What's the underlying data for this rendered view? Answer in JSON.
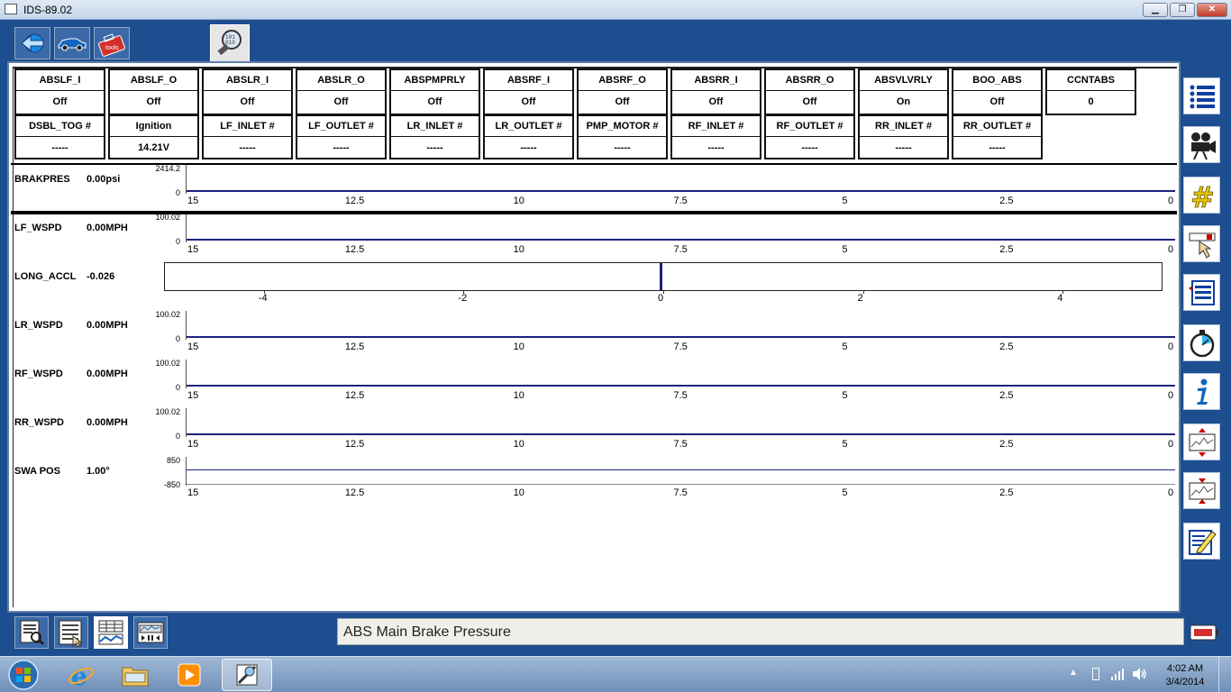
{
  "window": {
    "title": "IDS-89.02"
  },
  "top_toolbar": [
    {
      "name": "back-arrow-icon",
      "active": false
    },
    {
      "name": "vehicle-icon",
      "active": false
    },
    {
      "name": "toolbox-icon",
      "active": false
    },
    {
      "name": "datalogger-magnifier-icon",
      "active": true
    }
  ],
  "pids": [
    {
      "label": "ABSLF_I",
      "value": "Off"
    },
    {
      "label": "ABSLF_O",
      "value": "Off"
    },
    {
      "label": "ABSLR_I",
      "value": "Off"
    },
    {
      "label": "ABSLR_O",
      "value": "Off"
    },
    {
      "label": "ABSPMPRLY",
      "value": "Off"
    },
    {
      "label": "ABSRF_I",
      "value": "Off"
    },
    {
      "label": "ABSRF_O",
      "value": "Off"
    },
    {
      "label": "ABSRR_I",
      "value": "Off"
    },
    {
      "label": "ABSRR_O",
      "value": "Off"
    },
    {
      "label": "ABSVLVRLY",
      "value": "On"
    },
    {
      "label": "BOO_ABS",
      "value": "Off"
    },
    {
      "label": "CCNTABS",
      "value": "0"
    },
    {
      "label": "DSBL_TOG #",
      "value": "-----"
    },
    {
      "label": "Ignition",
      "value": "14.21V"
    },
    {
      "label": "LF_INLET #",
      "value": "-----"
    },
    {
      "label": "LF_OUTLET #",
      "value": "-----"
    },
    {
      "label": "LR_INLET #",
      "value": "-----"
    },
    {
      "label": "LR_OUTLET #",
      "value": "-----"
    },
    {
      "label": "PMP_MOTOR #",
      "value": "-----"
    },
    {
      "label": "RF_INLET #",
      "value": "-----"
    },
    {
      "label": "RF_OUTLET #",
      "value": "-----"
    },
    {
      "label": "RR_INLET #",
      "value": "-----"
    },
    {
      "label": "RR_OUTLET #",
      "value": "-----"
    }
  ],
  "time_axis_ticks": [
    "15",
    "12.5",
    "10",
    "7.5",
    "5",
    "2.5",
    "0"
  ],
  "plots": [
    {
      "name": "BRAKPRES",
      "value": "0.00psi",
      "ymax": "2414.2",
      "ymin": "0"
    },
    {
      "name": "LF_WSPD",
      "value": "0.00MPH",
      "ymax": "100.02",
      "ymin": "0"
    },
    {
      "name": "LONG_ACCL",
      "value": "-0.026",
      "type": "bar",
      "range": [
        -5,
        5
      ],
      "current": -0.026,
      "ticks": [
        "-4",
        "-2",
        "0",
        "2",
        "4"
      ]
    },
    {
      "name": "LR_WSPD",
      "value": "0.00MPH",
      "ymax": "100.02",
      "ymin": "0"
    },
    {
      "name": "RF_WSPD",
      "value": "0.00MPH",
      "ymax": "100.02",
      "ymin": "0"
    },
    {
      "name": "RR_WSPD",
      "value": "0.00MPH",
      "ymax": "100.02",
      "ymin": "0"
    },
    {
      "name": "SWA POS",
      "value": "1.00°",
      "ymax": "850",
      "ymin": "-850"
    }
  ],
  "right_tools": [
    "list-icon",
    "video-camera-icon",
    "hash-icon",
    "pointer-select-icon",
    "pid-list-icon",
    "stopwatch-icon",
    "info-icon",
    "expand-graph-icon",
    "shrink-graph-icon",
    "edit-pencil-icon"
  ],
  "bottom_tabs": [
    {
      "name": "search-report-icon",
      "active": false
    },
    {
      "name": "data-list-icon",
      "active": false
    },
    {
      "name": "grid-graph-icon",
      "active": true
    },
    {
      "name": "playback-icon",
      "active": false
    }
  ],
  "status": {
    "text": "ABS Main Brake Pressure"
  },
  "taskbar": {
    "apps": [
      "windows-start-icon",
      "internet-explorer-icon",
      "file-explorer-icon",
      "media-player-icon",
      "ids-app-icon"
    ],
    "time": "4:02 AM",
    "date": "3/4/2014"
  },
  "colors": {
    "background": "#1d4e8f",
    "trace": "#1a237e"
  }
}
